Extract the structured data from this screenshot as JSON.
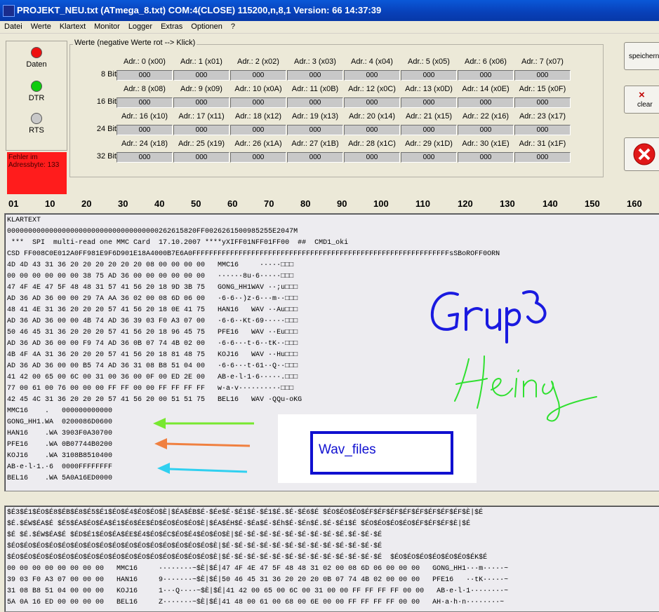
{
  "title": "PROJEKT_NEU.txt (ATmega_8.txt)    COM:4(CLOSE)    115200,n,8,1      Version: 66      14:37:39",
  "menu": [
    "Datei",
    "Werte",
    "Klartext",
    "Monitor",
    "Logger",
    "Extras",
    "Optionen",
    "?"
  ],
  "leds": [
    {
      "label": "Daten",
      "color": "#ee1010"
    },
    {
      "label": "DTR",
      "color": "#10cc10"
    },
    {
      "label": "RTS",
      "color": "#c8c8c8"
    }
  ],
  "error_text": "Fehler im Adressbyte: 133",
  "werte": {
    "title": "Werte (negative Werte rot --> Klick)",
    "row_labels": [
      "8 Bit",
      "16 Bit",
      "24 Bit",
      "32 Bit"
    ],
    "addresses": [
      [
        "Adr.: 0 (x00)",
        "Adr.: 1 (x01)",
        "Adr.: 2 (x02)",
        "Adr.: 3 (x03)",
        "Adr.: 4 (x04)",
        "Adr.: 5 (x05)",
        "Adr.: 6 (x06)",
        "Adr.: 7 (x07)"
      ],
      [
        "Adr.: 8 (x08)",
        "Adr.: 9 (x09)",
        "Adr.: 10 (x0A)",
        "Adr.: 11 (x0B)",
        "Adr.: 12 (x0C)",
        "Adr.: 13 (x0D)",
        "Adr.: 14 (x0E)",
        "Adr.: 15 (x0F)"
      ],
      [
        "Adr.: 16 (x10)",
        "Adr.: 17 (x11)",
        "Adr.: 18 (x12)",
        "Adr.: 19 (x13)",
        "Adr.: 20 (x14)",
        "Adr.: 21 (x15)",
        "Adr.: 22 (x16)",
        "Adr.: 23 (x17)"
      ],
      [
        "Adr.: 24 (x18)",
        "Adr.: 25 (x19)",
        "Adr.: 26 (x1A)",
        "Adr.: 27 (x1B)",
        "Adr.: 28 (x1C)",
        "Adr.: 29 (x1D)",
        "Adr.: 30 (x1E)",
        "Adr.: 31 (x1F)"
      ]
    ],
    "cell_value": "000"
  },
  "buttons": {
    "save": "speichern",
    "clear": "clear",
    "clear_icon": "×"
  },
  "scale": [
    "01",
    "10",
    "20",
    "30",
    "40",
    "50",
    "60",
    "70",
    "80",
    "90",
    "100",
    "110",
    "120",
    "130",
    "140",
    "150",
    "160"
  ],
  "klartext_lines": [
    "KLARTEXT",
    "000000000000000000000000000000000000262615820FF0026261500985255E2047M",
    " ***  SPI  multi-read one MMC Card  17.10.2007 ****yXIFF01NFF01FF00  ##  CMD1_oki",
    "CSD FF008C0E012A0FF981E9F6D901E18A4000B7E6A0FFFFFFFFFFFFFFFFFFFFFFFFFFFFFFFFFFFFFFFFFFFFFFFFFFFFFFFFFFFFFsSBoROFF0ORN",
    "4D 4D 43 31 36 20 20 20 20 20 20 08 00 00 00 00   MMC16     ·····□□□",
    "00 00 00 00 00 00 38 75 AD 36 00 00 00 00 00 00   ······8u·6·····□□□",
    "47 4F 4E 47 5F 48 48 31 57 41 56 20 18 9D 3B 75   GONG_HH1WAV ··;u□□□",
    "AD 36 AD 36 00 00 29 7A AA 36 02 00 08 6D 06 00   ·6·6··)z·6···m··□□□",
    "48 41 4E 31 36 20 20 20 57 41 56 20 18 0E 41 75   HAN16   WAV ··Au□□□",
    "AD 36 AD 36 00 00 4B 74 AD 36 39 03 F0 A3 07 00   ·6·6··Kt·69·····□□□",
    "50 46 45 31 36 20 20 20 57 41 56 20 18 96 45 75   PFE16   WAV ··Eu□□□",
    "AD 36 AD 36 00 00 F9 74 AD 36 0B 07 74 4B 02 00   ·6·6···t·6··tK··□□□",
    "4B 4F 4A 31 36 20 20 20 57 41 56 20 18 81 48 75   KOJ16   WAV ··Hu□□□",
    "AD 36 AD 36 00 00 B5 74 AD 36 31 08 B8 51 04 00   ·6·6···t·61··Q··□□□",
    "41 42 00 65 00 6C 00 31 00 36 00 0F 00 ED 2E 00   AB·e·l·1·6·····.□□□",
    "77 00 61 00 76 00 00 00 FF FF 00 00 FF FF FF FF   w·a·v··········□□□",
    "42 45 4C 31 36 20 20 20 57 41 56 20 00 51 51 75   BEL16   WAV ·QQu-oKG",
    "MMC16    .   000000000000",
    "GONG_HH1.WA  0200086D0600",
    "HAN16    .WA 3903F0A30700",
    "PFE16    .WA 0B07744B0200",
    "KOJ16    .WA 3108B8510400",
    "AB·e·l·1.·6  0000FFFFFFFF",
    "BEL16    .WA 5A0A16ED0000"
  ],
  "annotations": {
    "wav_label": "Wav_files"
  },
  "hex_lines": [
    "$É3$É1$ÉO$É8$ÉB$É8$É5$É1$ÉO$É4$ÉO$ÉO$È|$ÉA$ÉB$É·$Ée$É·$É1$É·$É1$É.$É·$É6$É $ÉO$ÉO$ÉO$ÉF$ÉF$ÉF$ÉF$ÉF$ÉF$ÉF$ÉF$È|$É",
    "$É.$ÉW$ÉA$É $É5$ÉA$ÉO$ÉA$É1$É6$ÉE$ÉD$ÉO$ÉO$ÉO$È|$ÉA$ÉH$É·$Éa$É·$Éh$É·$Én$É.$É·$É1$É $ÉO$ÉO$ÉO$ÉO$ÉF$ÉF$ÉF$È|$É",
    "$É $É.$ÉW$ÉA$É $ÉD$É1$ÉO$ÉA$ÉE$É4$ÉO$ÉC$ÉO$É4$ÉO$ÉO$È|$É·$É·$É·$É·$É·$É·$É·$É·$É.$É·$É·$É",
    "$ÉO$ÉO$ÉO$ÉO$ÉO$ÉO$ÉO$ÉO$ÉO$ÉO$ÉO$ÉO$ÉO$ÉO$ÉO$ÉO$È|$É·$É·$É·$É·$É·$É·$É·$É·$É·$É·$É·$É·$É",
    "$ÉO$ÉO$ÉO$ÉO$ÉO$ÉO$ÉO$ÉO$ÉO$ÉO$ÉO$ÉO$ÉO$ÉO$ÉO$ÉO$È|$É·$É·$É·$É·$É·$É·$É·$É·$É·$É·$É·$É·$É  $ÉO$ÉO$ÉO$ÉO$ÉO$ÉO$ÉK$É",
    "00 00 00 00 00 00 00 00   MMC16     ········~$È|$É|47 4F 4E 47 5F 48 48 31 02 00 08 6D 06 00 00 00   GONG_HH1···m·····~",
    "39 03 F0 A3 07 00 00 00   HAN16     9·······~$È|$É|50 46 45 31 36 20 20 20 0B 07 74 4B 02 00 00 00   PFE16   ··tK·····~",
    "31 08 B8 51 04 00 00 00   KOJ16     1···Q····~$È|$É|41 42 00 65 00 6C 00 31 00 00 FF FF FF FF 00 00   AB·e·l·1········~",
    "5A 0A 16 ED 00 00 00 00   BEL16     Z·······~$È|$É|41 48 00 61 00 68 00 6E 00 00 FF FF FF FF 00 00   AH·a·h·n········~"
  ]
}
